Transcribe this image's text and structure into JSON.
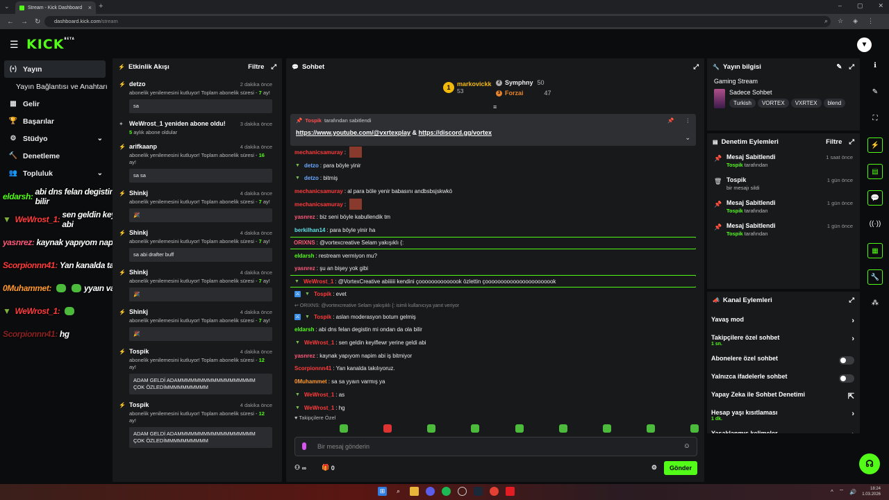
{
  "browser": {
    "tab_title": "Stream - Kick Dashboard",
    "url_host": "dashboard.kick.com",
    "url_path": "/stream"
  },
  "brand": {
    "logo": "KICK",
    "beta": "BETA",
    "accent": "#53fc18"
  },
  "nav": {
    "items": [
      {
        "label": "Yayın",
        "icon": "broadcast-icon"
      },
      {
        "label": "Yayın Bağlantısı ve Anahtarı",
        "icon": ""
      },
      {
        "label": "Gelir",
        "icon": "dollar-icon"
      },
      {
        "label": "Başarılar",
        "icon": "trophy-icon"
      },
      {
        "label": "Stüdyo",
        "icon": "studio-icon"
      },
      {
        "label": "Denetleme",
        "icon": "hammer-icon"
      },
      {
        "label": "Topluluk",
        "icon": "community-icon"
      }
    ]
  },
  "overlay": [
    {
      "user": "eldarsh:",
      "text": "abi dns felan degistin mi ondan da ola bilir",
      "color": "#53fc18"
    },
    {
      "user": "WeWrost_1:",
      "text": "sen geldin keyiflewr yerine geldi abi",
      "color": "#ff3b3b"
    },
    {
      "user": "yasnrez:",
      "text": "kaynak yapıyom napim abi iş bitmiyor",
      "color": "#ff5a7a"
    },
    {
      "user": "Scorpionnn41:",
      "text": "Yan kanalda takılıyoruz.",
      "color": "#ff3b3b"
    },
    {
      "user": "0Muhammet:",
      "text": "yyaın varmış ya",
      "color": "#ff9a2e"
    },
    {
      "user": "WeWrost_1:",
      "text": "",
      "color": "#ff3b3b"
    },
    {
      "user": "Scorpionnn41:",
      "text": "hg",
      "color": "#8a2222"
    }
  ],
  "activity": {
    "title": "Etkinlik Akışı",
    "filter": "Filtre",
    "items": [
      {
        "name": "detzo",
        "time": "2 dakika önce",
        "desc": "abonelik yenilemesini kutluyor! Toplam abonelik süresi - ",
        "months": "7",
        "suffix": " ay!",
        "msg": "sa"
      },
      {
        "name": "WeWrost_1 yeniden abone oldu!",
        "time": "3 dakika önce",
        "desc": "",
        "months": "5",
        "suffix": " aylık abone oldular",
        "msg": ""
      },
      {
        "name": "arifkaanp",
        "time": "4 dakika önce",
        "desc": "abonelik yenilemesini kutluyor! Toplam abonelik süresi - ",
        "months": "16",
        "suffix": " ay!",
        "msg": "sa sa"
      },
      {
        "name": "Shinkj",
        "time": "4 dakika önce",
        "desc": "abonelik yenilemesini kutluyor! Toplam abonelik süresi - ",
        "months": "7",
        "suffix": " ay!",
        "msg": "🎉"
      },
      {
        "name": "Shinkj",
        "time": "4 dakika önce",
        "desc": "abonelik yenilemesini kutluyor! Toplam abonelik süresi - ",
        "months": "7",
        "suffix": " ay!",
        "msg": "sa abi drafter buff"
      },
      {
        "name": "Shinkj",
        "time": "4 dakika önce",
        "desc": "abonelik yenilemesini kutluyor! Toplam abonelik süresi - ",
        "months": "7",
        "suffix": " ay!",
        "msg": "🎉"
      },
      {
        "name": "Shinkj",
        "time": "4 dakika önce",
        "desc": "abonelik yenilemesini kutluyor! Toplam abonelik süresi - ",
        "months": "7",
        "suffix": " ay!",
        "msg": "🎉"
      },
      {
        "name": "Tospik",
        "time": "4 dakika önce",
        "desc": "abonelik yenilemesini kutluyor! Toplam abonelik süresi - ",
        "months": "12",
        "suffix": " ay!",
        "msg": "ADAM GELDİ ADAMMMMMMMMMMMMMMMMMM ÇOK ÖZLEDİMMMMMMMMMM"
      },
      {
        "name": "Tospik",
        "time": "4 dakika önce",
        "desc": "abonelik yenilemesini kutluyor! Toplam abonelik süresi - ",
        "months": "12",
        "suffix": " ay!",
        "msg": "ADAM GELDİ ADAMMMMMMMMMMMMMMMMMM ÇOK ÖZLEDİMMMMMMMMMM"
      }
    ]
  },
  "chat": {
    "title": "Sohbet",
    "top": [
      {
        "name": "markovickk",
        "value": "53"
      },
      {
        "name": "Symphny",
        "value": "50"
      },
      {
        "name": "Forzai",
        "value": "47"
      }
    ],
    "pinned": {
      "by": "Tospik",
      "label": "tarafından sabitlendi",
      "link1": "https://www.youtube.com/@vxrtexplay",
      "amp": "&",
      "link2": "https://discord.gg/vortex"
    },
    "messages": [
      {
        "user": "mechanicsamuray",
        "text": "",
        "color": "#ff3b3b",
        "badge": "",
        "emote": true
      },
      {
        "user": "detzo",
        "text": "para böyle yinir",
        "color": "#6aa9ff",
        "badge": "v"
      },
      {
        "user": "detzo",
        "text": "bitmiş",
        "color": "#6aa9ff",
        "badge": "v"
      },
      {
        "user": "mechanicsamuray",
        "text": "al para böle yenir babasını andbsbsjskwkö",
        "color": "#ff3b3b",
        "badge": ""
      },
      {
        "user": "mechanicsamuray",
        "text": "",
        "color": "#ff3b3b",
        "badge": "",
        "emote": true
      },
      {
        "user": "yasnrez",
        "text": "biz seni böyle kabullendik tm",
        "color": "#ff5a7a",
        "badge": ""
      },
      {
        "user": "berkilhan14",
        "text": "para böyle yinir ha",
        "color": "#5de0e6",
        "badge": ""
      },
      {
        "user": "ORIXNS",
        "text": "@vortexcreative Selam yakışıklı {:",
        "color": "#ff5a7a",
        "badge": "",
        "hl": true
      },
      {
        "user": "eldarsh",
        "text": "restream vermiyon mu?",
        "color": "#53fc18",
        "badge": ""
      },
      {
        "user": "yasnrez",
        "text": "şu an bişey yok gibi",
        "color": "#ff5a7a",
        "badge": ""
      },
      {
        "user": "WeWrost_1",
        "text": "@VortexCreative abiiiiii kendini çoooooooooooook özlettin çooooooooooooooooooooook",
        "color": "#ff3b3b",
        "badge": "v",
        "hl": true
      },
      {
        "user": "Tospik",
        "text": "evet",
        "color": "#ff3b3b",
        "badge": "mv"
      },
      {
        "reply": "↩ ORIXNS: @vortexcreative Selam yakışıklı {: isimli kullanıcıya yanıt veriyor"
      },
      {
        "user": "Tospik",
        "text": "aslan moderasyon botum gelmiş",
        "color": "#ff3b3b",
        "badge": "mv"
      },
      {
        "user": "eldarsh",
        "text": "abi dns felan degistin mi ondan da ola bilir",
        "color": "#53fc18",
        "badge": ""
      },
      {
        "user": "WeWrost_1",
        "text": "sen geldin keyiflewr yerine geldi abi",
        "color": "#ff3b3b",
        "badge": "v"
      },
      {
        "user": "yasnrez",
        "text": "kaynak yapıyom napim abi iş bitmiyor",
        "color": "#ff5a7a",
        "badge": ""
      },
      {
        "user": "Scorpionnn41",
        "text": "Yan kanalda takılıyoruz.",
        "color": "#ff3b3b",
        "badge": ""
      },
      {
        "user": "0Muhammet",
        "text": "sa sa yyaın varmış ya",
        "color": "#ff9a2e",
        "badge": ""
      },
      {
        "user": "WeWrost_1",
        "text": "as",
        "color": "#ff3b3b",
        "badge": "v"
      },
      {
        "user": "WeWrost_1",
        "text": "hg",
        "color": "#ff3b3b",
        "badge": "v"
      }
    ],
    "followers_only": "♥ Takipçilere Özel",
    "placeholder": "Bir mesaj gönderin",
    "infinity": "∞",
    "count": "0",
    "send": "Gönder"
  },
  "info": {
    "title": "Yayın bilgisi",
    "category": "Gaming Stream",
    "mode": "Sadece Sohbet",
    "tags": [
      "Turkish",
      "VORTEX",
      "VXRTEX",
      "blend"
    ]
  },
  "modlog": {
    "title": "Denetim Eylemleri",
    "filter": "Filtre",
    "items": [
      {
        "t": "Mesaj Sabitlendi",
        "user": "Tospik",
        "s": "tarafından",
        "time": "1 saat önce",
        "icon": "pin-icon"
      },
      {
        "t": "Tospik",
        "user": "",
        "s": "bir mesajı sildi",
        "time": "1 gün önce",
        "icon": "trash-icon"
      },
      {
        "t": "Mesaj Sabitlendi",
        "user": "Tospik",
        "s": "tarafından",
        "time": "1 gün önce",
        "icon": "pin-icon"
      },
      {
        "t": "Mesaj Sabitlendi",
        "user": "Tospik",
        "s": "tarafından",
        "time": "1 gün önce",
        "icon": "pin-icon"
      }
    ]
  },
  "channel": {
    "title": "Kanal Eylemleri",
    "items": [
      {
        "label": "Yavaş mod",
        "sub": "",
        "ctl": "arrow"
      },
      {
        "label": "Takipçilere özel sohbet",
        "sub": "1 sn.",
        "ctl": "arrow"
      },
      {
        "label": "Abonelere özel sohbet",
        "sub": "",
        "ctl": "toggle"
      },
      {
        "label": "Yalnızca ifadelerle sohbet",
        "sub": "",
        "ctl": "toggle"
      },
      {
        "label": "Yapay Zeka ile Sohbet Denetimi",
        "sub": "",
        "ctl": "ext"
      },
      {
        "label": "Hesap yaşı kısıtlaması",
        "sub": "1 dk.",
        "ctl": "arrow"
      },
      {
        "label": "Yasaklanmış kelimeler",
        "sub": "",
        "ctl": "arrow"
      }
    ]
  },
  "clock": {
    "time": "18:24",
    "date": "1.03.2026"
  }
}
